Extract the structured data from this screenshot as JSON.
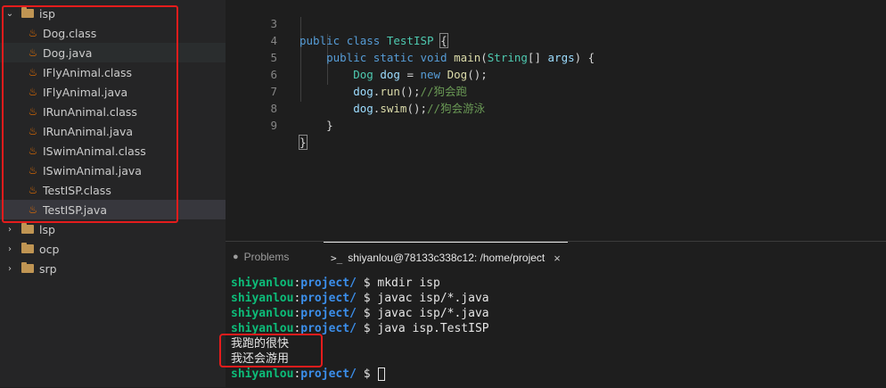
{
  "explorer": {
    "root_folder": "isp",
    "files": [
      "Dog.class",
      "Dog.java",
      "IFlyAnimal.class",
      "IFlyAnimal.java",
      "IRunAnimal.class",
      "IRunAnimal.java",
      "ISwimAnimal.class",
      "ISwimAnimal.java",
      "TestISP.class",
      "TestISP.java"
    ],
    "other_folders": [
      "lsp",
      "ocp",
      "srp"
    ],
    "highlight_color": "#e51c1c"
  },
  "editor": {
    "lines": [
      {
        "num": "3",
        "text": "public class TestISP {"
      },
      {
        "num": "4",
        "text": "    public static void main(String[] args) {"
      },
      {
        "num": "5",
        "text": "        Dog dog = new Dog();"
      },
      {
        "num": "6",
        "text": "        dog.run();//狗会跑"
      },
      {
        "num": "7",
        "text": "        dog.swim();//狗会游泳"
      },
      {
        "num": "8",
        "text": "    }"
      },
      {
        "num": "9",
        "text": "}"
      }
    ]
  },
  "panel": {
    "tabs": [
      {
        "label": "Problems",
        "icon": "info-icon"
      },
      {
        "label": "shiyanlou@78133c338c12: /home/project",
        "icon": "terminal-icon",
        "close": "×"
      }
    ]
  },
  "terminal": {
    "user": "shiyanlou",
    "sep": ":",
    "path": "project/",
    "prompt_symbol": " $ ",
    "commands": [
      "mkdir isp",
      "javac isp/*.java",
      "javac isp/*.java",
      "java isp.TestISP"
    ],
    "output": [
      "我跑的很快",
      "我还会游用"
    ]
  }
}
